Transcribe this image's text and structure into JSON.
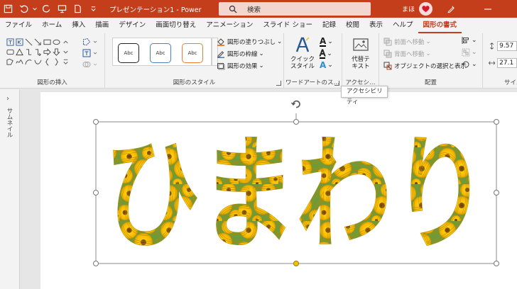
{
  "titlebar": {
    "doc_title": "プレゼンテーション1 - Power…",
    "search_placeholder": "検索",
    "user_name": "まほ",
    "background_color": "#c43e1c"
  },
  "tabs": [
    {
      "label": "ファイル"
    },
    {
      "label": "ホーム"
    },
    {
      "label": "挿入"
    },
    {
      "label": "描画"
    },
    {
      "label": "デザイン"
    },
    {
      "label": "画面切り替え"
    },
    {
      "label": "アニメーション"
    },
    {
      "label": "スライド ショー"
    },
    {
      "label": "記録"
    },
    {
      "label": "校閲"
    },
    {
      "label": "表示"
    },
    {
      "label": "ヘルプ"
    },
    {
      "label": "図形の書式",
      "active": true
    }
  ],
  "ribbon": {
    "insert_shapes": {
      "label": "図形の挿入"
    },
    "shape_styles": {
      "label": "図形のスタイル",
      "preview_text": "Abc",
      "fill": "図形の塗りつぶし",
      "outline": "図形の枠線",
      "effects": "図形の効果"
    },
    "wordart": {
      "label": "ワードアートのス…",
      "quick_style": "クイック\nスタイル"
    },
    "accessibility": {
      "label": "アクセシ…",
      "alt_text": "代替テ\nキスト"
    },
    "arrange": {
      "label": "配置",
      "bring_forward": "前面へ移動",
      "send_backward": "背面へ移動",
      "selection_pane": "オブジェクトの選択と表示"
    },
    "size": {
      "label": "サイズ",
      "height": "9.57",
      "width": "27.1"
    }
  },
  "tooltip": "アクセシビリティ",
  "thumbnail_pane": {
    "label": "サムネイル"
  },
  "slide": {
    "wordart_text": "ひまわり"
  },
  "colors": {
    "accent": "#c43e1c",
    "selection_handle": "#ffffff",
    "adjust_handle": "#f4c20d"
  }
}
